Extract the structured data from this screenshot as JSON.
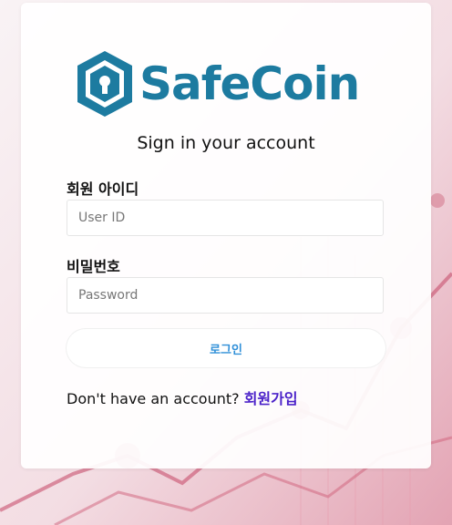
{
  "brand": {
    "name": "SafeCoin",
    "icon": "shield-lock-icon"
  },
  "form": {
    "title": "Sign in your account",
    "userid_label": "회원 아이디",
    "userid_placeholder": "User ID",
    "password_label": "비밀번호",
    "password_placeholder": "Password",
    "login_label": "로그인"
  },
  "footer": {
    "prompt": "Don't have an account? ",
    "signup_link": "회원가입"
  },
  "colors": {
    "brand": "#1d7ba0",
    "button_text": "#2f8fd8",
    "link": "#4b22c9"
  }
}
